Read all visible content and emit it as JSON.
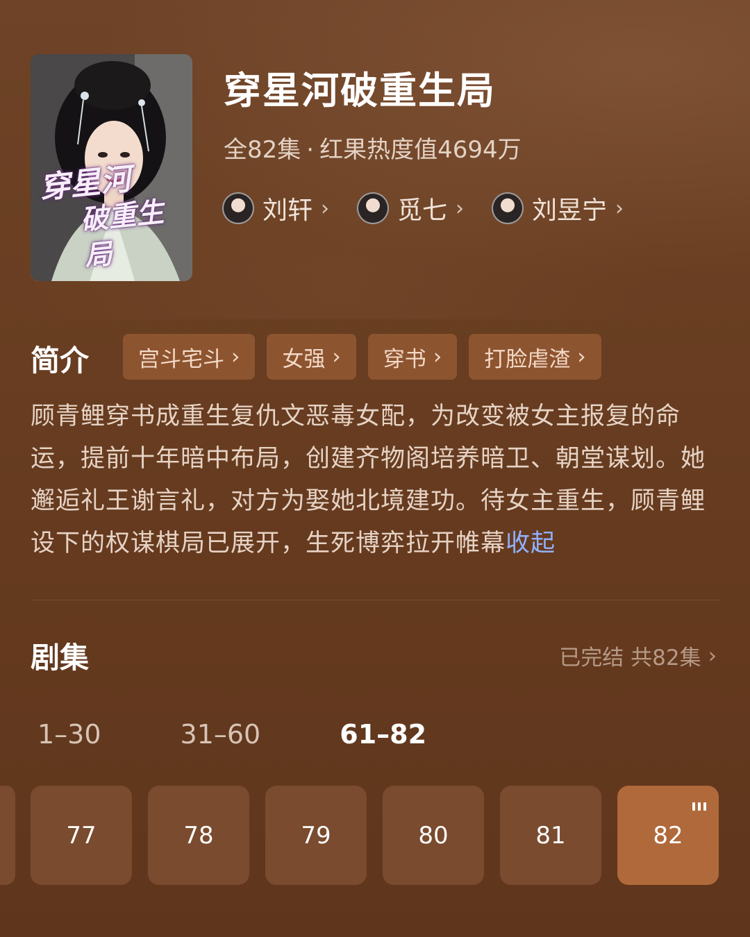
{
  "show": {
    "title": "穿星河破重生局",
    "meta_episodes": "全82集",
    "meta_separator": "·",
    "meta_heat": "红果热度值4694万",
    "poster_title_line1": "穿星河",
    "poster_title_line2": "破重生局"
  },
  "cast": [
    {
      "name": "刘轩"
    },
    {
      "name": "觅七"
    },
    {
      "name": "刘昱宁"
    }
  ],
  "intro": {
    "label": "简介",
    "tags": [
      "宫斗宅斗",
      "女强",
      "穿书",
      "打脸虐渣"
    ],
    "description": "顾青鲤穿书成重生复仇文恶毒女配，为改变被女主报复的命运，提前十年暗中布局，创建齐物阁培养暗卫、朝堂谋划。她邂逅礼王谢言礼，对方为娶她北境建功。待女主重生，顾青鲤设下的权谋棋局已展开，生死博弈拉开帷幕",
    "collapse_label": "收起"
  },
  "episodes": {
    "label": "剧集",
    "status": "已完结 共82集",
    "ranges": [
      "1–30",
      "31–60",
      "61–82"
    ],
    "active_range": "61–82",
    "items": [
      "77",
      "78",
      "79",
      "80",
      "81",
      "82"
    ],
    "current": "82"
  },
  "icons": {
    "chevron": "chevron-right-icon",
    "playing": "playing-bars-icon"
  },
  "colors": {
    "background": "#6a3f22",
    "tag_bg": "#8d5430",
    "episode_bg": "#7a4b2e",
    "episode_active": "#b0693a",
    "collapse_link": "#8fb2ff"
  }
}
